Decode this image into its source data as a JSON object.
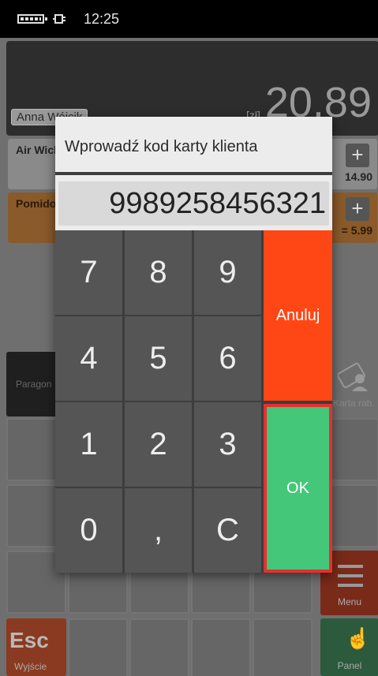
{
  "status_bar": {
    "time": "12:25"
  },
  "background": {
    "customer": "Anna Wójcik",
    "currency": "[zł]",
    "total": "20,89",
    "items": [
      {
        "name": "Air Wick",
        "price": "14.90"
      },
      {
        "name": "Pomidory",
        "price": "= 5.99"
      }
    ],
    "buttons": {
      "paragon": "Paragon",
      "karta": "Karta rab.",
      "menu": "Menu",
      "esc": "Esc",
      "esc_sub": "Wyjście",
      "panel": "Panel"
    }
  },
  "dialog": {
    "title": "Wprowadź kod karty klienta",
    "code_value": "9989258456321",
    "keys": [
      "7",
      "8",
      "9",
      "4",
      "5",
      "6",
      "1",
      "2",
      "3",
      "0",
      ",",
      "C"
    ],
    "cancel_label": "Anuluj",
    "ok_label": "OK"
  },
  "colors": {
    "cancel": "#ff4716",
    "ok": "#44c779",
    "ok_border": "#e53030",
    "key": "#555555"
  }
}
